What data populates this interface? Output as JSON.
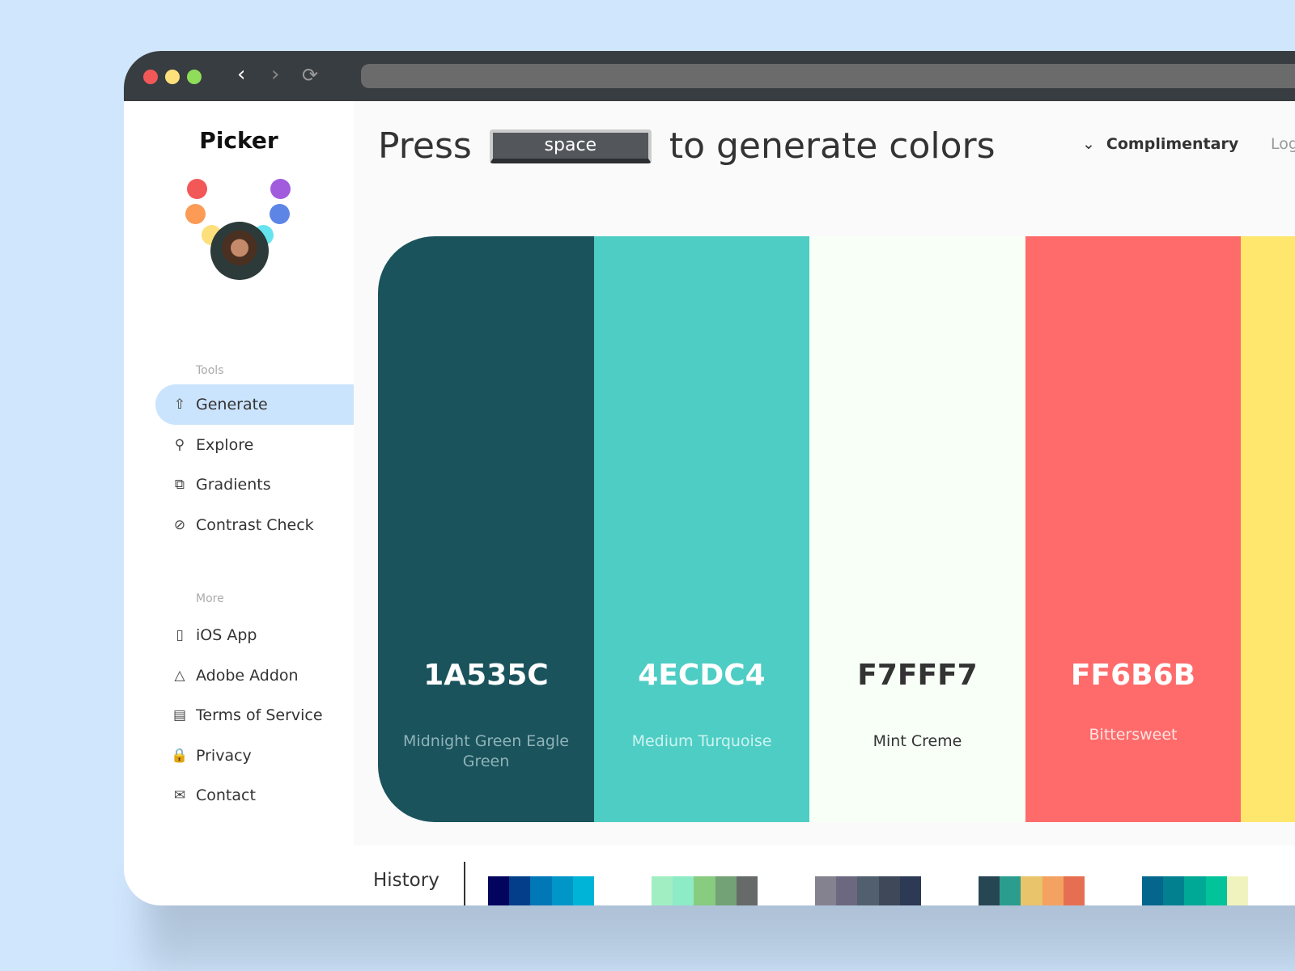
{
  "window": {
    "traffic_lights": [
      "#f25858",
      "#fde07c",
      "#8fdd58"
    ],
    "back": "‹",
    "forward": "›",
    "reload": "⟳"
  },
  "sidebar": {
    "logo": "Picker",
    "avatar_dots": [
      "#f25858",
      "#a15cde",
      "#fb9b55",
      "#5d85e6",
      "#fde07c",
      "#96e05a",
      "#66e4ee"
    ],
    "tools_heading": "Tools",
    "tools": [
      {
        "label": "Generate",
        "icon": "⇧"
      },
      {
        "label": "Explore",
        "icon": "⚲"
      },
      {
        "label": "Gradients",
        "icon": "⧉"
      },
      {
        "label": "Contrast Check",
        "icon": "⊘"
      }
    ],
    "more_heading": "More",
    "more": [
      {
        "label": "iOS App",
        "icon": "▯"
      },
      {
        "label": "Adobe Addon",
        "icon": "△"
      },
      {
        "label": "Terms of Service",
        "icon": "▤"
      },
      {
        "label": "Privacy",
        "icon": "🔒"
      },
      {
        "label": "Contact",
        "icon": "✉"
      }
    ]
  },
  "header": {
    "press": "Press",
    "key": "space",
    "rest": "to generate colors",
    "mode": "Complimentary",
    "mode_icon": "⌄",
    "login": "Log"
  },
  "swatches": [
    {
      "hex": "1A535C",
      "color": "#1a535c",
      "text": "#ffffff",
      "name_color": "#8fb3b8",
      "name": "Midnight Green Eagle Green"
    },
    {
      "hex": "4ECDC4",
      "color": "#4ecdc4",
      "text": "#ffffff",
      "name_color": "#cdf3f0",
      "name": "Medium Turquoise"
    },
    {
      "hex": "F7FFF7",
      "color": "#f7fff7",
      "text": "#333333",
      "name_color": "#333333",
      "name": "Mint Creme"
    },
    {
      "hex": "FF6B6B",
      "color": "#ff6b6b",
      "text": "#ffffff",
      "name_color": "#ffe3e3",
      "name": "Bittersweet"
    },
    {
      "hex": "",
      "color": "#ffe66d",
      "text": "#333333",
      "name_color": "#333333",
      "name": ""
    }
  ],
  "history": {
    "label": "History",
    "palettes": [
      [
        "#03045e",
        "#023e8a",
        "#0077b6",
        "#0096c7",
        "#00b4d8"
      ],
      [
        "#a1eec3",
        "#8debc5",
        "#88cc80",
        "#72a276",
        "#666a68"
      ],
      [
        "#85828f",
        "#6b6880",
        "#525f6e",
        "#3e4859",
        "#2c3a55"
      ],
      [
        "#264653",
        "#2a9d8f",
        "#e9c46a",
        "#f4a261",
        "#e76f51"
      ],
      [
        "#05668d",
        "#028090",
        "#00a896",
        "#02c39a",
        "#f0f3bd"
      ]
    ]
  }
}
